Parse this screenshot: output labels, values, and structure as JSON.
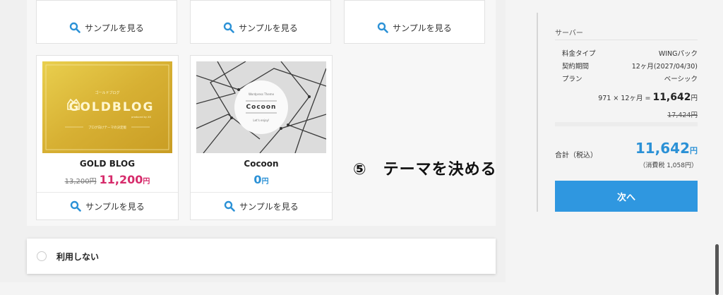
{
  "sample_label": "サンプルを見る",
  "themes": [
    {
      "name": "GOLD BLOG",
      "original_price": "13,200円",
      "price": "11,200",
      "currency": "円"
    },
    {
      "name": "Cocoon",
      "price": "0",
      "currency": "円"
    }
  ],
  "gold_logo": {
    "small_jp": "ゴールドブログ",
    "title": "GOLDBLOG",
    "byline": "produced by XX",
    "caption": "ブログ向けテーマの決定版"
  },
  "cocoon_logo": {
    "small": "Wordpress Theme",
    "title": "Cocoon",
    "sub": "Let's enjoy!"
  },
  "no_use_label": "利用しない",
  "annotation": "⑤　テーマを決める",
  "summary": {
    "section": "サーバー",
    "rows": [
      {
        "label": "料金タイプ",
        "value": "WINGパック"
      },
      {
        "label": "契約期間",
        "value": "12ヶ月(2027/04/30)"
      },
      {
        "label": "プラン",
        "value": "ベーシック"
      }
    ],
    "calc_prefix": "971 × 12ヶ月 =",
    "calc_amount": "11,642",
    "calc_yen": "円",
    "strike_price": "17,424円",
    "total_label": "合計（税込）",
    "total_amount": "11,642",
    "total_yen": "円",
    "tax_note": "（消費税 1,058円）",
    "next_button": "次へ"
  },
  "colors": {
    "accent_blue": "#2b91d6",
    "sale_pink": "#d62b6b",
    "button_blue": "#2f97e0",
    "gold": "#d9b73a"
  }
}
